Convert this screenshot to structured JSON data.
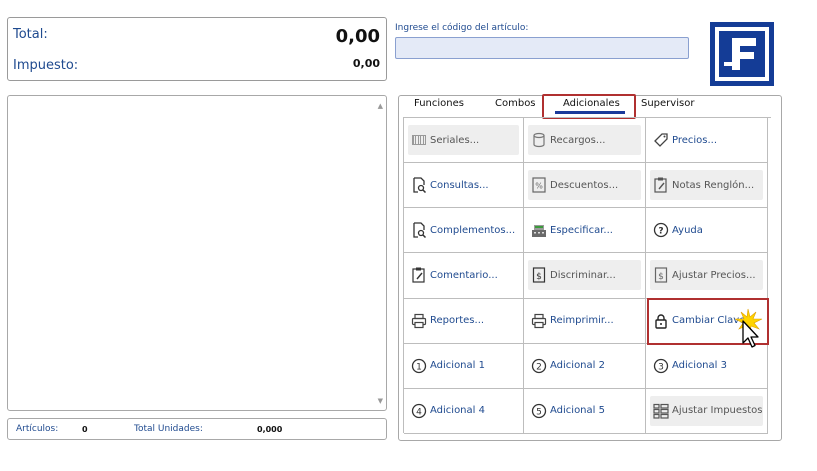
{
  "totals": {
    "total_label": "Total:",
    "total_value": "0,00",
    "tax_label": "Impuesto:",
    "tax_value": "0,00"
  },
  "code": {
    "label": "Ingrese el código del artículo:",
    "value": ""
  },
  "status": {
    "articles_label": "Artículos:",
    "articles_value": "0",
    "units_label": "Total Unidades:",
    "units_value": "0,000"
  },
  "tabs": [
    {
      "label": "Funciones",
      "active": false
    },
    {
      "label": "Combos",
      "active": false
    },
    {
      "label": "Adicionales",
      "active": true
    },
    {
      "label": "Supervisor",
      "active": false
    }
  ],
  "buttons": [
    {
      "label": "Seriales...",
      "icon": "barcode-icon",
      "enabled": false
    },
    {
      "label": "Recargos...",
      "icon": "database-icon",
      "enabled": false
    },
    {
      "label": "Precios...",
      "icon": "price-tag-icon",
      "enabled": true
    },
    {
      "label": "Consultas...",
      "icon": "document-search-icon",
      "enabled": true
    },
    {
      "label": "Descuentos...",
      "icon": "percent-document-icon",
      "enabled": false
    },
    {
      "label": "Notas Renglón...",
      "icon": "clipboard-edit-icon",
      "enabled": false
    },
    {
      "label": "Complementos...",
      "icon": "document-search-icon",
      "enabled": true
    },
    {
      "label": "Especificar...",
      "icon": "register-icon",
      "enabled": true
    },
    {
      "label": "Ayuda",
      "icon": "help-icon",
      "enabled": true
    },
    {
      "label": "Comentario...",
      "icon": "clipboard-edit-icon",
      "enabled": true
    },
    {
      "label": "Discriminar...",
      "icon": "dollar-document-icon",
      "enabled": false
    },
    {
      "label": "Ajustar Precios...",
      "icon": "dollar-document-icon",
      "enabled": false
    },
    {
      "label": "Reportes...",
      "icon": "printer-icon",
      "enabled": true
    },
    {
      "label": "Reimprimir...",
      "icon": "printer-icon",
      "enabled": true
    },
    {
      "label": "Cambiar Clave",
      "icon": "lock-icon",
      "enabled": true
    },
    {
      "label": "Adicional 1",
      "icon": "circle-1-icon",
      "enabled": true
    },
    {
      "label": "Adicional 2",
      "icon": "circle-2-icon",
      "enabled": true
    },
    {
      "label": "Adicional 3",
      "icon": "circle-3-icon",
      "enabled": true
    },
    {
      "label": "Adicional 4",
      "icon": "circle-4-icon",
      "enabled": true
    },
    {
      "label": "Adicional 5",
      "icon": "circle-5-icon",
      "enabled": true
    },
    {
      "label": "Ajustar Impuestos...",
      "icon": "grid-list-icon",
      "enabled": false
    }
  ],
  "colors": {
    "accent": "#1f4a8f",
    "logo_blue": "#143c96",
    "highlight_red": "#b03030"
  }
}
